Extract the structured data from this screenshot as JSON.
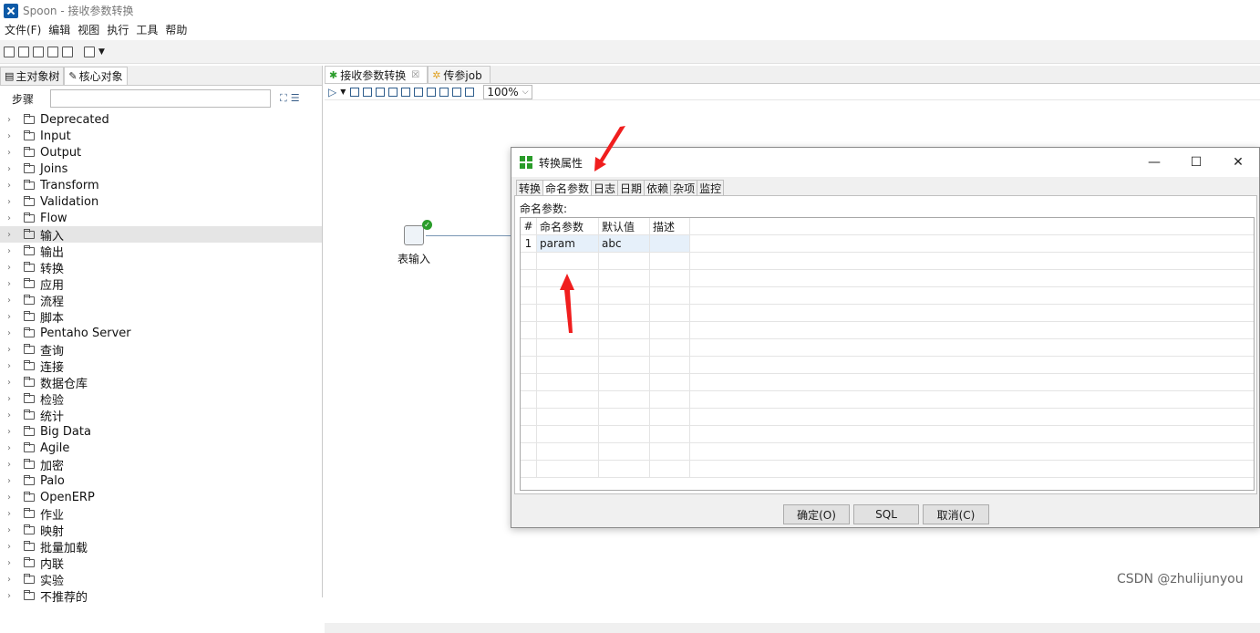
{
  "window": {
    "title": "Spoon - 接收参数转换"
  },
  "menu": [
    "文件(F)",
    "编辑",
    "视图",
    "执行",
    "工具",
    "帮助"
  ],
  "left_panel": {
    "tabs": [
      "主对象树",
      "核心对象"
    ],
    "search_label": "步骤",
    "tree": [
      "Deprecated",
      "Input",
      "Output",
      "Joins",
      "Transform",
      "Validation",
      "Flow",
      "输入",
      "输出",
      "转换",
      "应用",
      "流程",
      "脚本",
      "Pentaho Server",
      "查询",
      "连接",
      "数据仓库",
      "检验",
      "统计",
      "Big Data",
      "Agile",
      "加密",
      "Palo",
      "OpenERP",
      "作业",
      "映射",
      "批量加载",
      "内联",
      "实验",
      "不推荐的"
    ],
    "selected_index": 7
  },
  "editor": {
    "tabs": [
      {
        "label": "接收参数转换",
        "close": "☒"
      },
      {
        "label": "传参job"
      }
    ],
    "zoom": "100%",
    "step_label": "表输入"
  },
  "dialog": {
    "title": "转换属性",
    "controls": {
      "minimize": "—",
      "maximize": "☐",
      "close": "✕"
    },
    "tabs": [
      "转换",
      "命名参数",
      "日志",
      "日期",
      "依赖",
      "杂项",
      "监控"
    ],
    "active_tab": 1,
    "section_label": "命名参数:",
    "columns": [
      "#",
      "命名参数",
      "默认值",
      "描述"
    ],
    "rows": [
      {
        "num": "1",
        "name": "param",
        "default": "abc",
        "desc": ""
      }
    ],
    "buttons": {
      "ok": "确定(O)",
      "sql": "SQL",
      "cancel": "取消(C)"
    }
  },
  "watermark": "CSDN @zhulijunyou",
  "colors": {
    "accent": "#2a9c2a",
    "arrow": "#f01e1e"
  }
}
